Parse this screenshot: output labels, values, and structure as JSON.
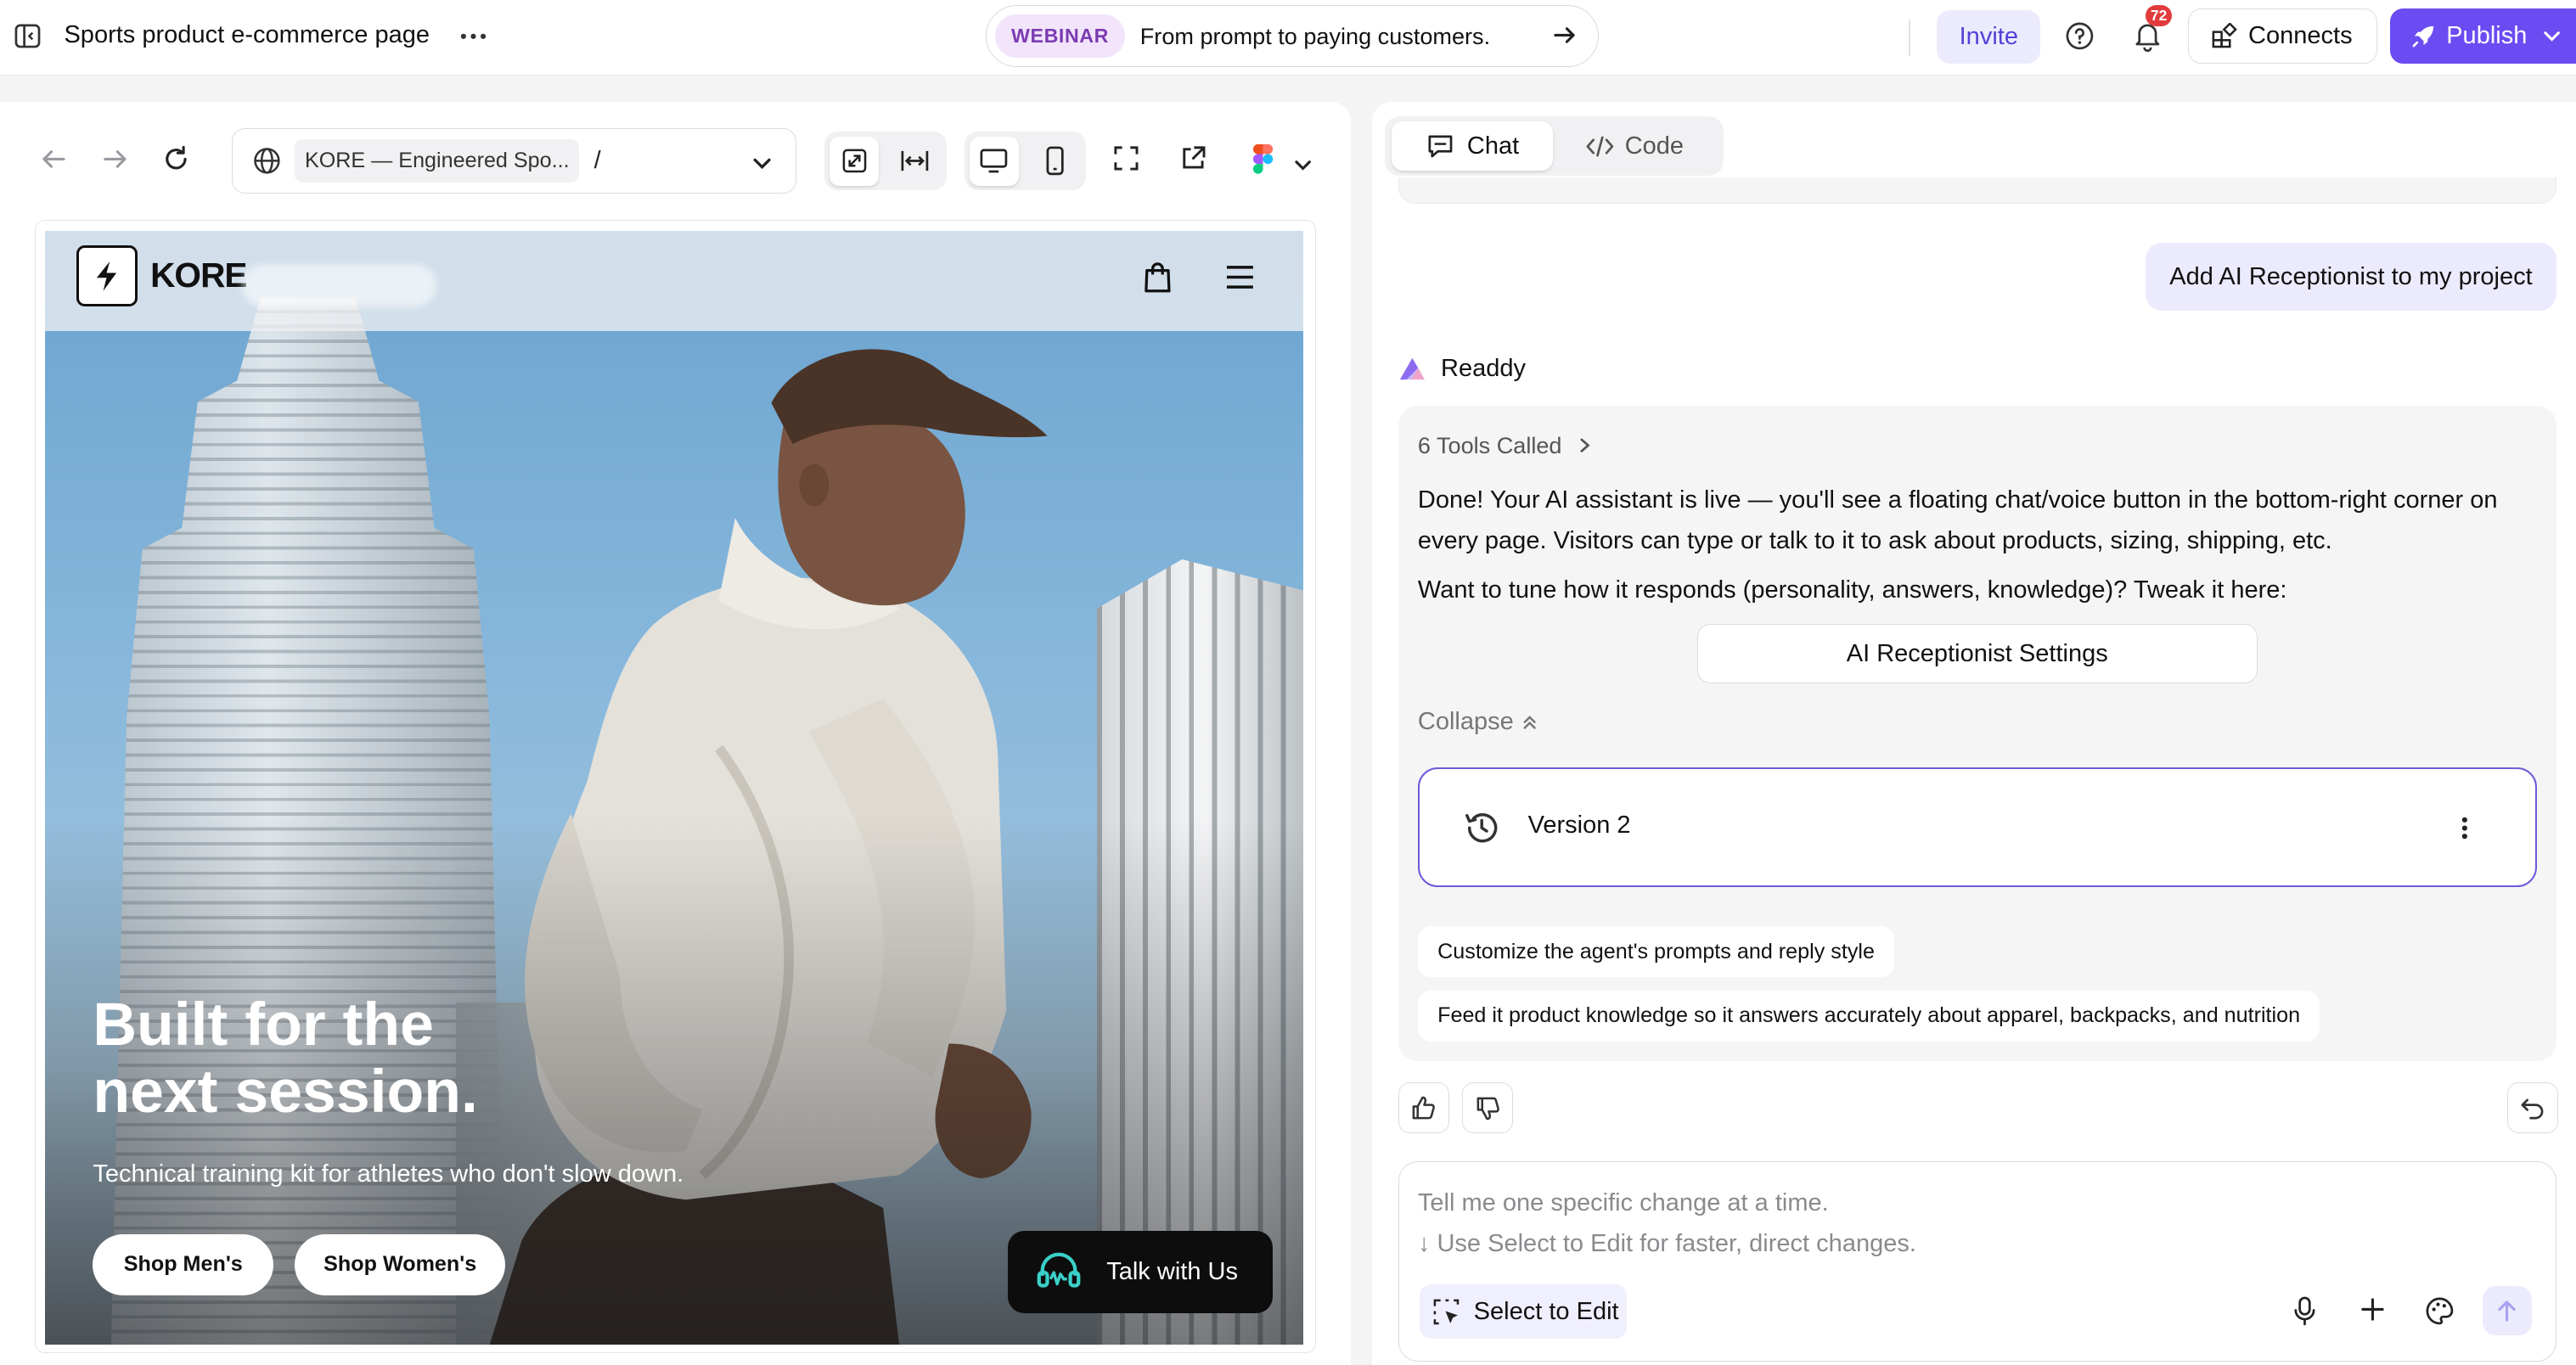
{
  "topbar": {
    "project_title": "Sports product e-commerce page",
    "webinar_tag": "WEBINAR",
    "webinar_text": "From prompt to paying customers.",
    "invite_label": "Invite",
    "notification_count": "72",
    "connects_label": "Connects",
    "publish_label": "Publish",
    "accent_color": "#6a4cf2"
  },
  "preview": {
    "url_chip": "KORE — Engineered Spo...",
    "url_path": "/",
    "site": {
      "logo_text": "KORE",
      "hero_title_line1": "Built for the",
      "hero_title_line2": "next session.",
      "hero_subtitle": "Technical training kit for athletes who don't slow down.",
      "shop_men_label": "Shop Men's",
      "shop_women_label": "Shop Women's",
      "talk_label": "Talk with Us"
    }
  },
  "chat": {
    "tabs": [
      {
        "label": "Chat",
        "active": true
      },
      {
        "label": "Code",
        "active": false
      }
    ],
    "user_message": "Add AI Receptionist to my project",
    "assistant_name": "Readdy",
    "tools_called": "6 Tools Called",
    "reply_p1": "Done! Your AI assistant is live — you'll see a floating chat/voice button in the bottom-right corner on every page. Visitors can type or talk to it to ask about products, sizing, shipping, etc.",
    "reply_p2": "Want to tune how it responds (personality, answers, knowledge)? Tweak it here:",
    "settings_button": "AI Receptionist Settings",
    "collapse_label": "Collapse",
    "version_label": "Version 2",
    "suggestions": [
      "Customize the agent's prompts and reply style",
      "Feed it product knowledge so it answers accurately about apparel, backpacks, and nutrition"
    ],
    "composer_placeholder_1": "Tell me one specific change at a time.",
    "composer_placeholder_2": "↓ Use Select to Edit for faster, direct changes.",
    "select_to_edit_label": "Select to Edit"
  }
}
